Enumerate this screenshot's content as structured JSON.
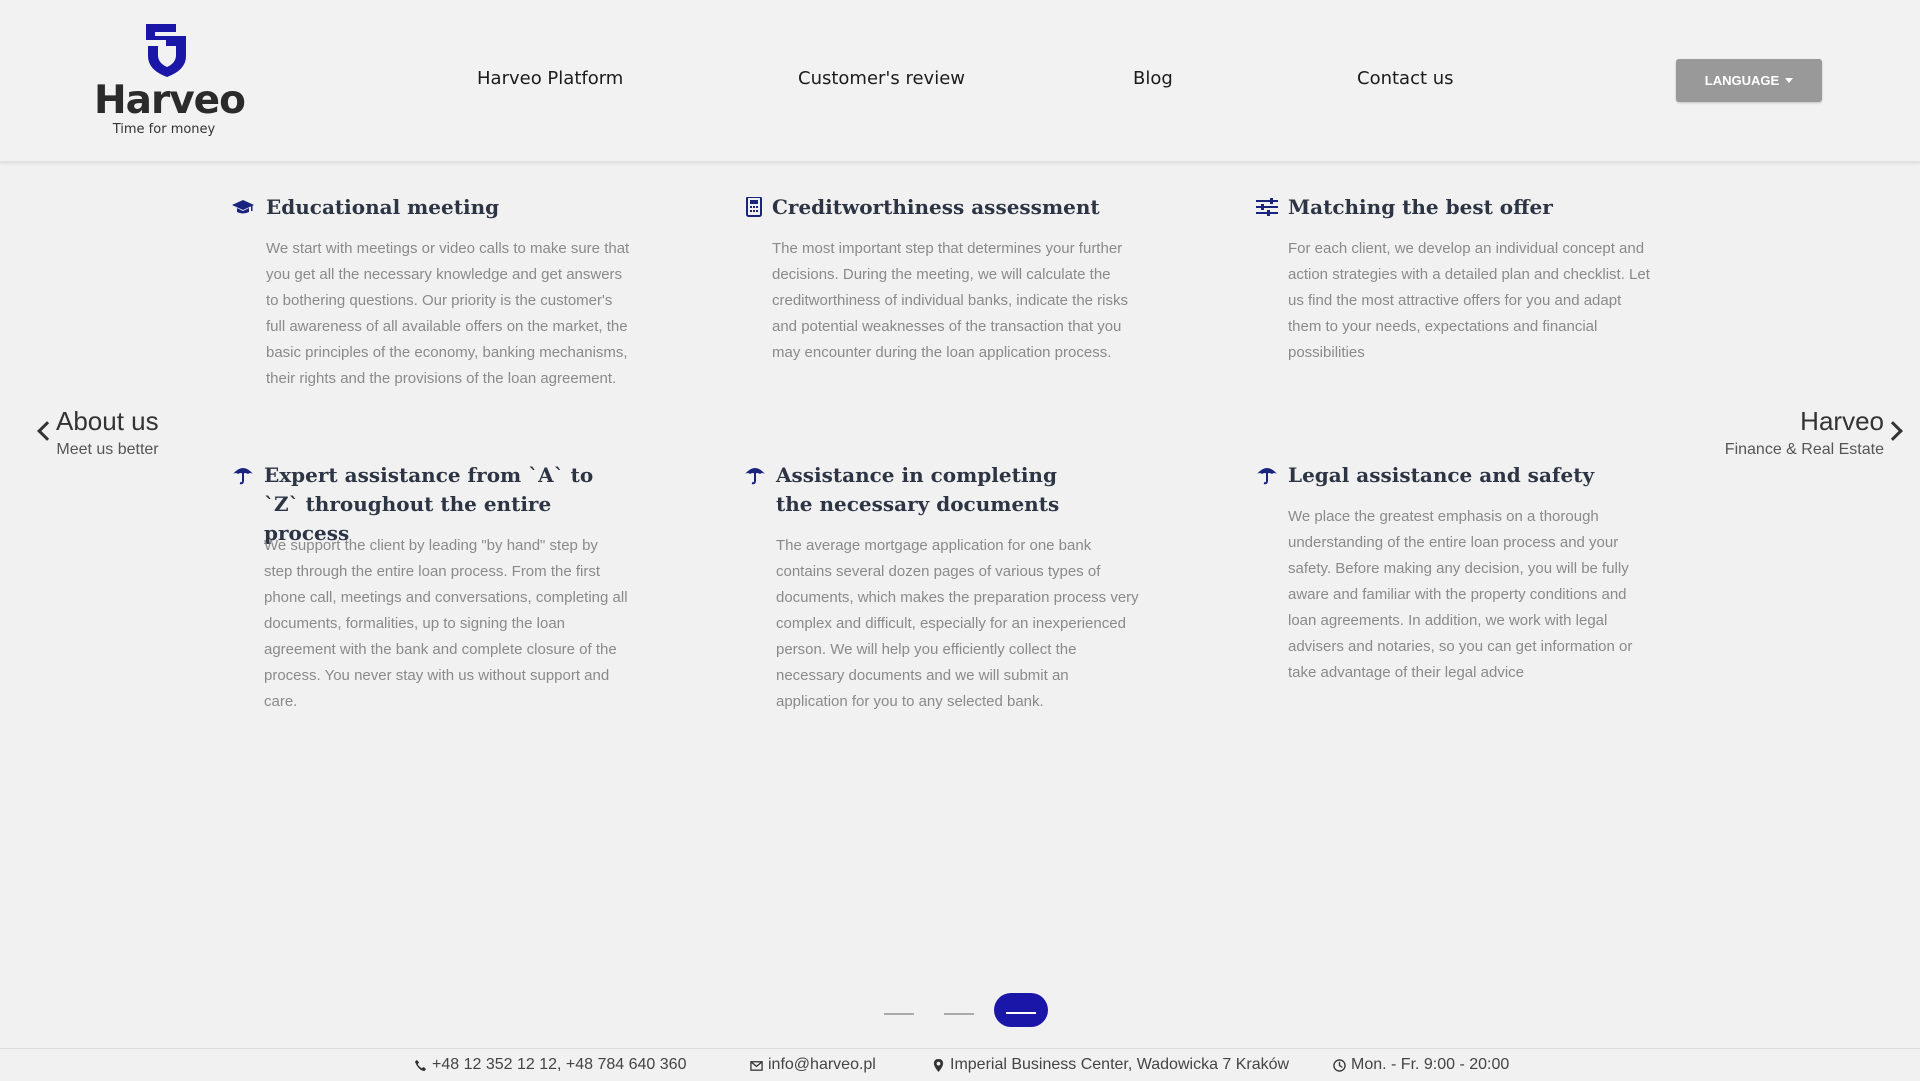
{
  "brand": {
    "name": "Harveo",
    "tagline": "Time for money",
    "accent_color": "#1a16a8"
  },
  "nav": {
    "items": [
      {
        "label": "Harveo Platform"
      },
      {
        "label": "Customer's review"
      },
      {
        "label": "Blog"
      },
      {
        "label": "Contact us"
      }
    ],
    "language_button": "LANGUAGE"
  },
  "carousel": {
    "prev": {
      "title": "About us",
      "subtitle": "Meet us better"
    },
    "next": {
      "title": "Harveo",
      "subtitle": "Finance & Real Estate"
    },
    "pages": 3,
    "active_page": 3
  },
  "features": [
    {
      "icon": "graduation-cap-icon",
      "title": "Educational meeting",
      "text": "We start with meetings or video calls to make sure that you get all the necessary knowledge and get answers to bothering questions. Our priority is the customer's full awareness of all available offers on the market, the basic principles of the economy, banking mechanisms, their rights and the provisions of the loan agreement."
    },
    {
      "icon": "calculator-icon",
      "title": "Creditworthiness assessment",
      "text": "The most important step that determines your further decisions. During the meeting, we will calculate the creditworthiness of individual banks, indicate the risks and potential weaknesses of the transaction that you may encounter during the loan application process."
    },
    {
      "icon": "sliders-icon",
      "title": "Matching the best offer",
      "text": "For each client, we develop an individual concept and action strategies with a detailed plan and checklist. Let us find the most attractive offers for you and adapt them to your needs, expectations and financial possibilities"
    },
    {
      "icon": "umbrella-icon",
      "title": "Expert assistance from `A` to `Z` throughout the entire process",
      "text": "We support the client by leading \"by hand\" step by step through the entire loan process. From the first phone call, meetings and conversations, completing all documents, formalities, up to signing the loan agreement with the bank and complete closure of the process. You never stay with us without support and care."
    },
    {
      "icon": "umbrella-icon",
      "title": "Assistance in completing the necessary documents",
      "text": "The average mortgage application for one bank contains several dozen pages of various types of documents, which makes the preparation process very complex and difficult, especially for an inexperienced person. We will help you efficiently collect the necessary documents and we will submit an application for you to any selected bank."
    },
    {
      "icon": "umbrella-icon",
      "title": "Legal assistance and safety",
      "text": "We place the greatest emphasis on a thorough understanding of the entire loan process and your safety. Before making any decision, you will be fully aware and familiar with the property conditions and loan agreements. In addition, we work with legal advisers and notaries, so you can get information or take advantage of their legal advice"
    }
  ],
  "footer": {
    "phone": "+48 12 352 12 12, +48 784 640 360",
    "email": "info@harveo.pl",
    "address": "Imperial Business Center, Wadowicka 7 Kraków",
    "hours": "Mon. - Fr. 9:00 - 20:00"
  }
}
